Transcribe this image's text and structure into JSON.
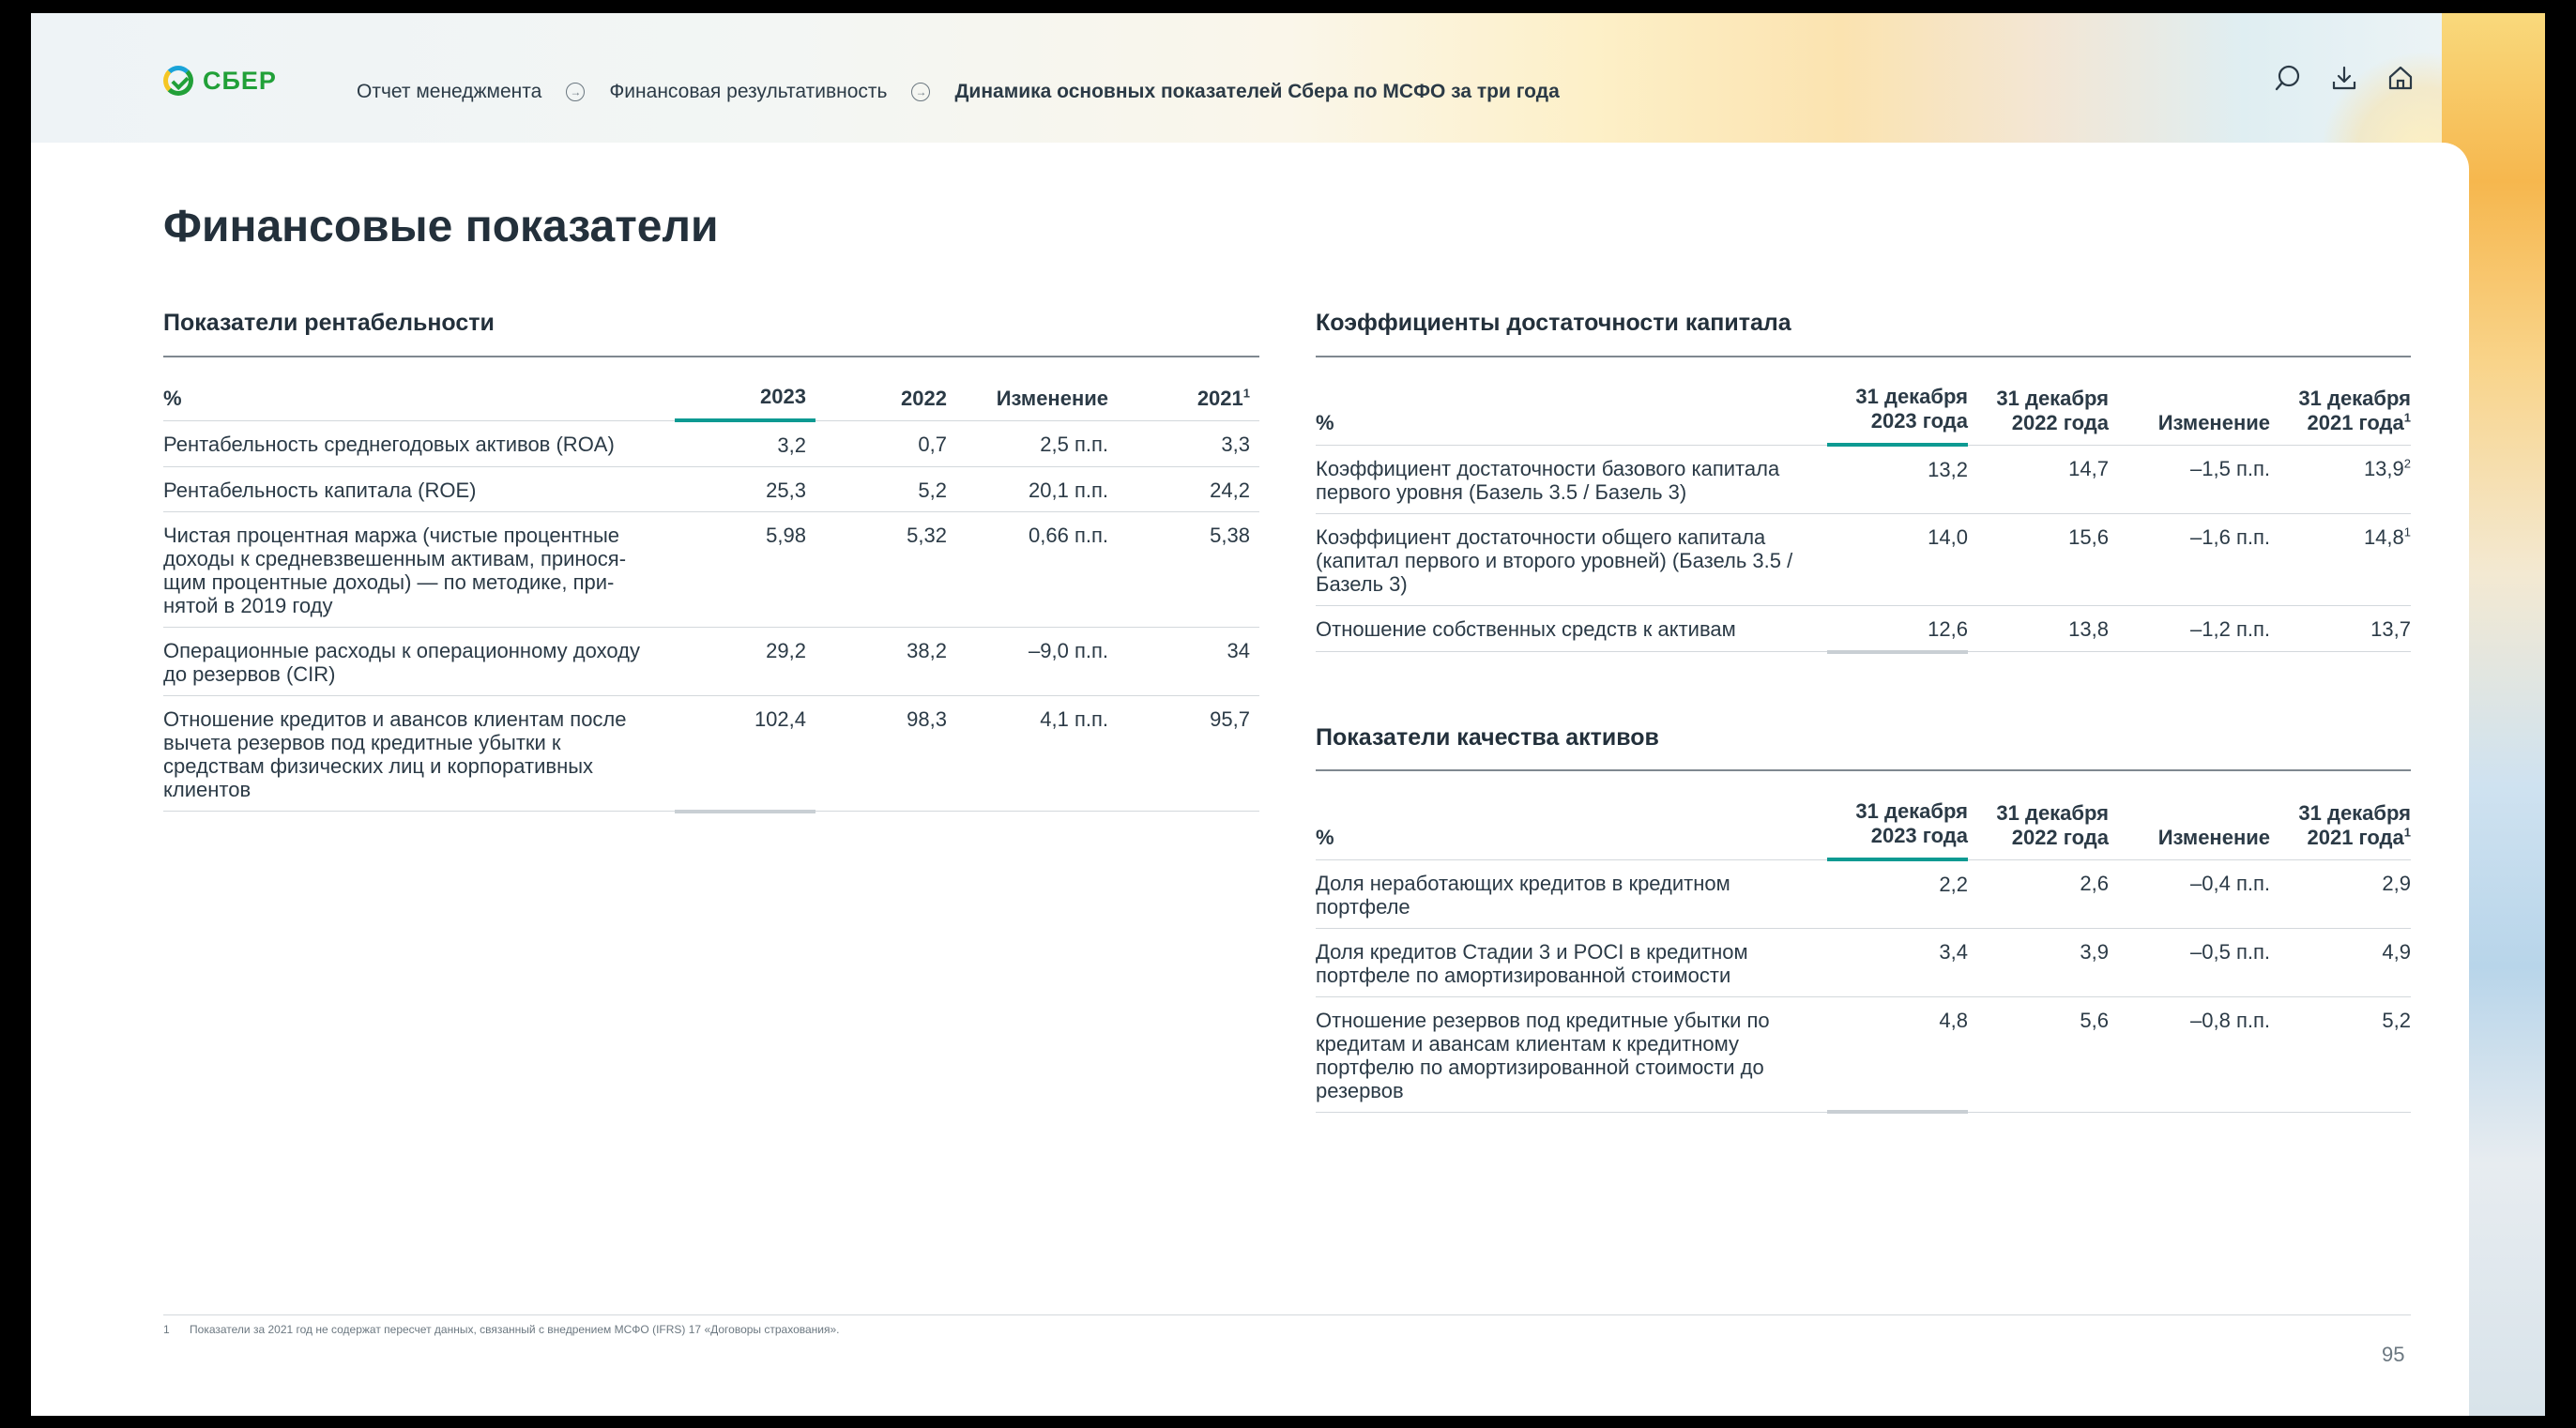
{
  "header": {
    "logo_text": "СБЕР",
    "breadcrumbs": [
      {
        "label": "Отчет менеджмента"
      },
      {
        "label": "Финансовая результативность"
      },
      {
        "label": "Динамика основных показателей Сбера по МСФО за три года"
      }
    ],
    "tools": [
      "search-icon",
      "download-icon",
      "home-icon"
    ]
  },
  "page_title": "Финансовые показатели",
  "profitability": {
    "title": "Показатели рентабельности",
    "headers": {
      "label": "%",
      "c1": "2023",
      "c2": "2022",
      "c3": "Изменение",
      "c4": "2021",
      "c4_sup": "1"
    },
    "rows": [
      {
        "label": "Рентабельность среднегодовых активов (ROA)",
        "c1": "3,2",
        "c2": "0,7",
        "c3": "2,5 п.п.",
        "c4": "3,3"
      },
      {
        "label": "Рентабельность капитала (ROE)",
        "c1": "25,3",
        "c2": "5,2",
        "c3": "20,1 п.п.",
        "c4": "24,2"
      },
      {
        "label": "Чистая процентная маржа (чистые процентные доходы к средневзвешенным активам, принося-щим процентные доходы) — по методике, при-нятой в 2019 году",
        "c1": "5,98",
        "c2": "5,32",
        "c3": "0,66 п.п.",
        "c4": "5,38"
      },
      {
        "label": "Операционные расходы к операционному доходу до резервов (CIR)",
        "c1": "29,2",
        "c2": "38,2",
        "c3": "–9,0 п.п.",
        "c4": "34"
      },
      {
        "label": "Отношение кредитов и авансов клиентам после вычета резервов под кредитные убытки к средствам физических лиц и корпоративных клиентов",
        "c1": "102,4",
        "c2": "98,3",
        "c3": "4,1 п.п.",
        "c4": "95,7"
      }
    ]
  },
  "capital": {
    "title": "Коэффициенты достаточности капитала",
    "headers": {
      "label": "%",
      "c1": "31 декабря 2023 года",
      "c2": "31 декабря 2022 года",
      "c3": "Изменение",
      "c4": "31 декабря 2021 года",
      "c4_sup": "1"
    },
    "rows": [
      {
        "label": "Коэффициент достаточности базового капитала первого уровня (Базель 3.5 / Базель 3)",
        "c1": "13,2",
        "c2": "14,7",
        "c3": "–1,5 п.п.",
        "c4": "13,9",
        "c4_sup": "2"
      },
      {
        "label": "Коэффициент достаточности общего капитала (капитал первого и второго уровней) (Базель 3.5 / Базель 3)",
        "c1": "14,0",
        "c2": "15,6",
        "c3": "–1,6 п.п.",
        "c4": "14,8",
        "c4_sup": "1"
      },
      {
        "label": "Отношение собственных средств к активам",
        "c1": "12,6",
        "c2": "13,8",
        "c3": "–1,2 п.п.",
        "c4": "13,7",
        "c4_sup": ""
      }
    ]
  },
  "asset_quality": {
    "title": "Показатели качества активов",
    "headers": {
      "label": "%",
      "c1": "31 декабря 2023 года",
      "c2": "31 декабря 2022 года",
      "c3": "Изменение",
      "c4": "31 декабря 2021 года",
      "c4_sup": "1"
    },
    "rows": [
      {
        "label": "Доля неработающих кредитов в кредитном портфеле",
        "c1": "2,2",
        "c2": "2,6",
        "c3": "–0,4 п.п.",
        "c4": "2,9"
      },
      {
        "label": "Доля кредитов Стадии 3 и POCI в кредитном портфеле по амортизированной стоимости",
        "c1": "3,4",
        "c2": "3,9",
        "c3": "–0,5 п.п.",
        "c4": "4,9"
      },
      {
        "label": "Отношение резервов под кредитные убытки по кредитам и авансам клиентам к кредитному портфелю по амортизированной стоимости до резервов",
        "c1": "4,8",
        "c2": "5,6",
        "c3": "–0,8 п.п.",
        "c4": "5,2"
      }
    ]
  },
  "footnote": {
    "mark": "1",
    "text": "Показатели за 2021 год не содержат пересчет данных, связанный с внедрением МСФО (IFRS) 17 «Договоры страхования»."
  },
  "page_number": "95"
}
